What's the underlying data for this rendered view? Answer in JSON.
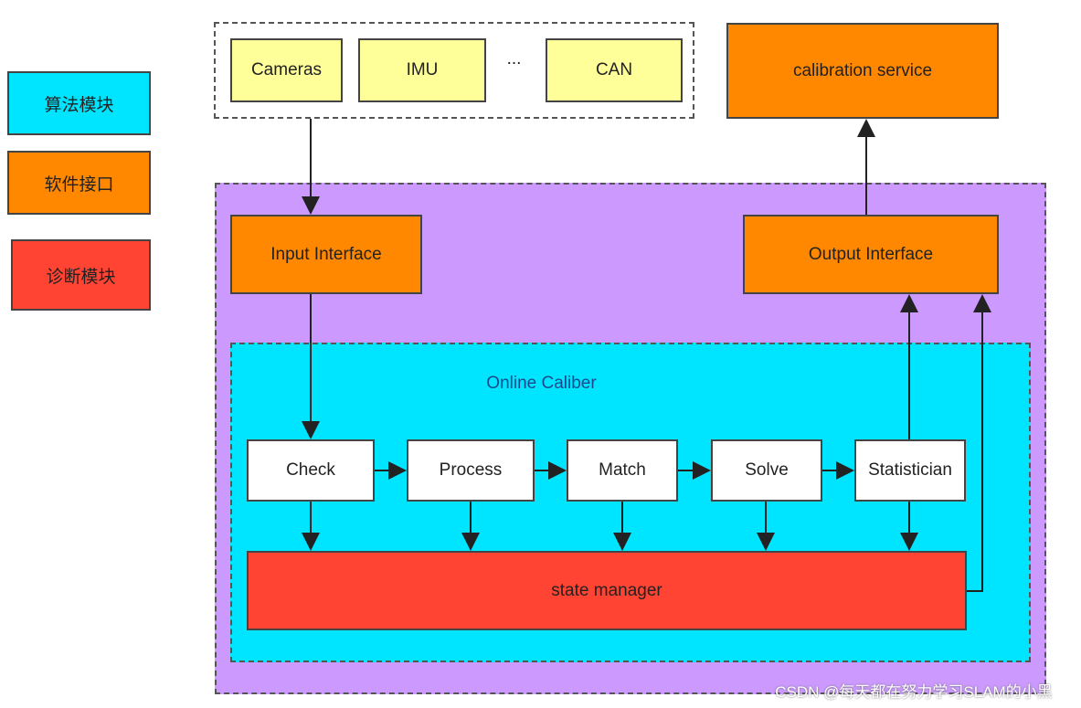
{
  "legend": [
    {
      "label": "算法模块",
      "color": "#00e5ff"
    },
    {
      "label": "软件接口",
      "color": "#ff8800"
    },
    {
      "label": "诊断模块",
      "color": "#ff4433"
    }
  ],
  "sensors": {
    "cameras": "Cameras",
    "imu": "IMU",
    "ellipsis": "...",
    "can": "CAN"
  },
  "calibration_service": "calibration service",
  "input_interface": "Input Interface",
  "output_interface": "Output Interface",
  "online_caliber": "Online Caliber",
  "pipeline": [
    "Check",
    "Process",
    "Match",
    "Solve",
    "Statistician"
  ],
  "state_manager": "state manager",
  "watermark": "CSDN @每天都在努力学习SLAM的小黑",
  "colors": {
    "sensor": "#ffff99",
    "interface": "#ff8800",
    "purple": "#cc99ff",
    "cyan": "#00e5ff",
    "state": "#ff4433"
  }
}
